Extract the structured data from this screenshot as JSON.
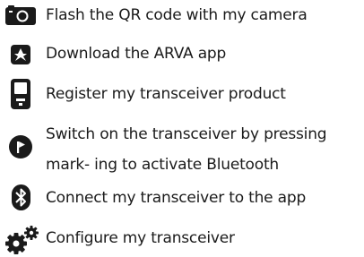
{
  "steps": [
    {
      "icon": "camera-icon",
      "text": "Flash the QR code with my camera"
    },
    {
      "icon": "arva-app-icon",
      "text": "Download the ARVA app"
    },
    {
      "icon": "transceiver-device-icon",
      "text": "Register my transceiver product"
    },
    {
      "icon": "power-flag-icon",
      "text": "Switch on the transceiver by pressing mark- ing to activate Bluetooth"
    },
    {
      "icon": "bluetooth-icon",
      "text": "Connect my transceiver to the app"
    },
    {
      "icon": "gears-icon",
      "text": "Configure my transceiver"
    }
  ],
  "colors": {
    "text": "#1a1a1a",
    "icon": "#1a1a1a",
    "background": "#ffffff"
  }
}
